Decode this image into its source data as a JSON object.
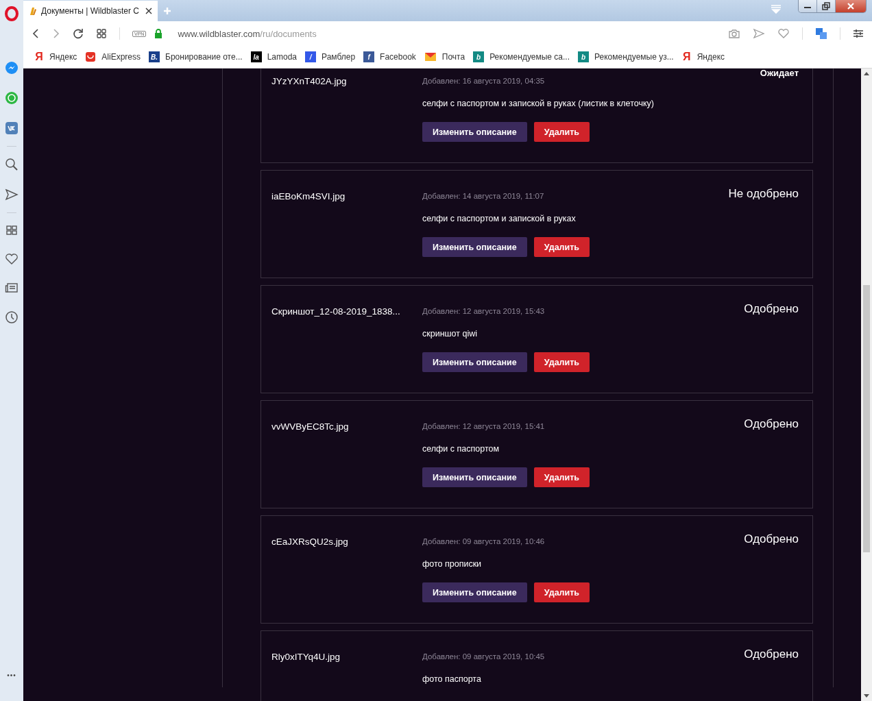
{
  "tab": {
    "title": "Документы | Wildblaster C",
    "selected": true
  },
  "address": {
    "vpn": "VPN",
    "host": "www.wildblaster.com",
    "path": "/ru/documents"
  },
  "bookmarks": [
    {
      "label": "Яндекс",
      "kind": "yandex",
      "glyph": "Я"
    },
    {
      "label": "AliExpress",
      "kind": "aliexpress"
    },
    {
      "label": "Бронирование оте...",
      "kind": "booking",
      "glyph": "B."
    },
    {
      "label": "Lamoda",
      "kind": "lamoda",
      "glyph": "la"
    },
    {
      "label": "Рамблер",
      "kind": "rambler",
      "glyph": "/"
    },
    {
      "label": "Facebook",
      "kind": "facebook",
      "glyph": "f"
    },
    {
      "label": "Почта",
      "kind": "mail"
    },
    {
      "label": "Рекомендуемые са...",
      "kind": "bing",
      "glyph": "b"
    },
    {
      "label": "Рекомендуемые уз...",
      "kind": "bing",
      "glyph": "b"
    },
    {
      "label": "Яндекс",
      "kind": "yandex",
      "glyph": "Я"
    }
  ],
  "sidebar": {
    "more": "•••"
  },
  "documents": [
    {
      "file": "JYzYXnT402A.jpg",
      "added": "Добавлен: 16 августа 2019, 04:35",
      "status": "Ожидает",
      "pending": true,
      "description": "селфи с паспортом и запиской в руках (листик в клеточку)",
      "buttons": [
        "Изменить описание",
        "Удалить"
      ]
    },
    {
      "file": "iaEBoKm4SVI.jpg",
      "added": "Добавлен: 14 августа 2019, 11:07",
      "status": "Не одобрено",
      "pending": false,
      "description": "селфи с паспортом и запиской в руках",
      "buttons": [
        "Изменить описание",
        "Удалить"
      ]
    },
    {
      "file": "Скриншот_12-08-2019_1838...",
      "added": "Добавлен: 12 августа 2019, 15:43",
      "status": "Одобрено",
      "pending": false,
      "description": "скриншот qiwi",
      "buttons": [
        "Изменить описание",
        "Удалить"
      ]
    },
    {
      "file": "vvWVByEC8Tc.jpg",
      "added": "Добавлен: 12 августа 2019, 15:41",
      "status": "Одобрено",
      "pending": false,
      "description": "селфи с паспортом",
      "buttons": [
        "Изменить описание",
        "Удалить"
      ]
    },
    {
      "file": "cEaJXRsQU2s.jpg",
      "added": "Добавлен: 09 августа 2019, 10:46",
      "status": "Одобрено",
      "pending": false,
      "description": "фото прописки",
      "buttons": [
        "Изменить описание",
        "Удалить"
      ]
    },
    {
      "file": "Rly0xITYq4U.jpg",
      "added": "Добавлен: 09 августа 2019, 10:45",
      "status": "Одобрено",
      "pending": false,
      "description": "фото паспорта"
    }
  ]
}
